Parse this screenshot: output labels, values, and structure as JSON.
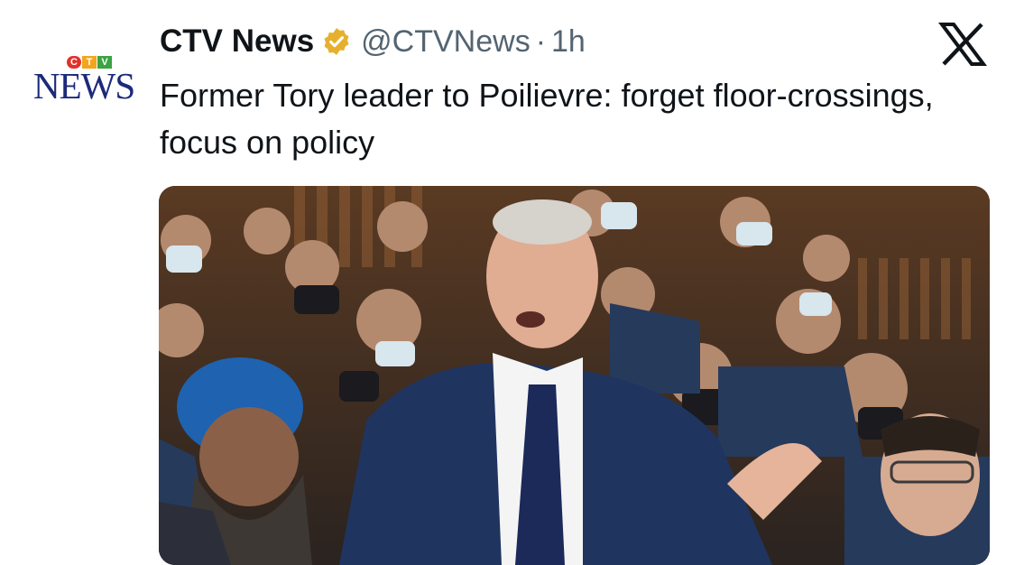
{
  "source": {
    "name": "CTV News",
    "handle": "@CTVNews",
    "separator": "·",
    "time": "1h",
    "logo_lettering": {
      "top": [
        "C",
        "T",
        "V"
      ],
      "bottom": "NEWS"
    },
    "brand_colors": {
      "c": "#e0322b",
      "t": "#f4a51c",
      "v": "#3aa342",
      "news": "#1c2a7a"
    }
  },
  "verified_badge": {
    "icon": "verified-gold-badge-icon",
    "color": "#e6b02f"
  },
  "platform_icon": "x-logo-icon",
  "headline": "Former Tory leader to Poilievre: forget floor-crossings, focus on policy",
  "photo": {
    "icon": "news-photo"
  }
}
